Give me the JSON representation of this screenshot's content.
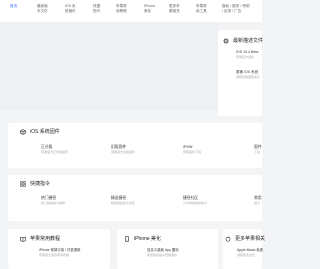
{
  "nav": {
    "items": [
      {
        "label": "首页"
      },
      {
        "label": "最新版\n本文件"
      },
      {
        "label": "iOS 系\n统固件"
      },
      {
        "label": "快捷\n指令"
      },
      {
        "label": "苹果常\n用教程"
      },
      {
        "label": "iPhone\n美化"
      },
      {
        "label": "更多苹\n果相关"
      },
      {
        "label": "苹果常\n用工具"
      },
      {
        "label": "隐私 / 服务 / 赞助\n/ 反馈 / 广告"
      }
    ]
  },
  "latest": {
    "title": "最新描述文件",
    "items": [
      {
        "title": "iOS 19.4 Beta",
        "desc": "苹果官方最新"
      },
      {
        "title": "屏蔽 iOS 系统",
        "desc": "屏蔽系统更新提示"
      }
    ]
  },
  "firmware": {
    "title": "iOS 系统固件",
    "items": [
      {
        "title": "正式版",
        "desc": "苹果官方正式版固件"
      },
      {
        "title": "旧版固件",
        "desc": "苹果官方旧版固件"
      },
      {
        "title": "iPSW",
        "desc": "苹果固件下载"
      },
      {
        "title": "固件",
        "desc": "下载"
      }
    ]
  },
  "shortcuts": {
    "title": "快捷指令",
    "items": [
      {
        "title": "热门捷径",
        "desc": "热门快捷指令推荐"
      },
      {
        "title": "精选捷径",
        "desc": "精选快捷指令合集"
      },
      {
        "title": "捷径社区",
        "desc": "分享你的快捷指令"
      },
      {
        "title": "常用",
        "desc": "指令"
      }
    ]
  },
  "tutorials": {
    "title": "苹果常用教程",
    "items": [
      {
        "title": "iPhone 抹掉订阅 / 付费退款",
        "desc": "苹果官方退款申请教程"
      }
    ]
  },
  "beautify": {
    "title": "iPhone 美化",
    "items": [
      {
        "title": "自定义桌面 App 图标",
        "desc": "使用快捷指令更换图标"
      }
    ]
  },
  "more": {
    "title": "更多苹果相关",
    "items": [
      {
        "title": "Apple Music 免费",
        "desc": "领取免费会员"
      }
    ]
  },
  "colors": {
    "accent": "#2f6bff",
    "background": "#f3f4f6",
    "card": "#ffffff"
  }
}
